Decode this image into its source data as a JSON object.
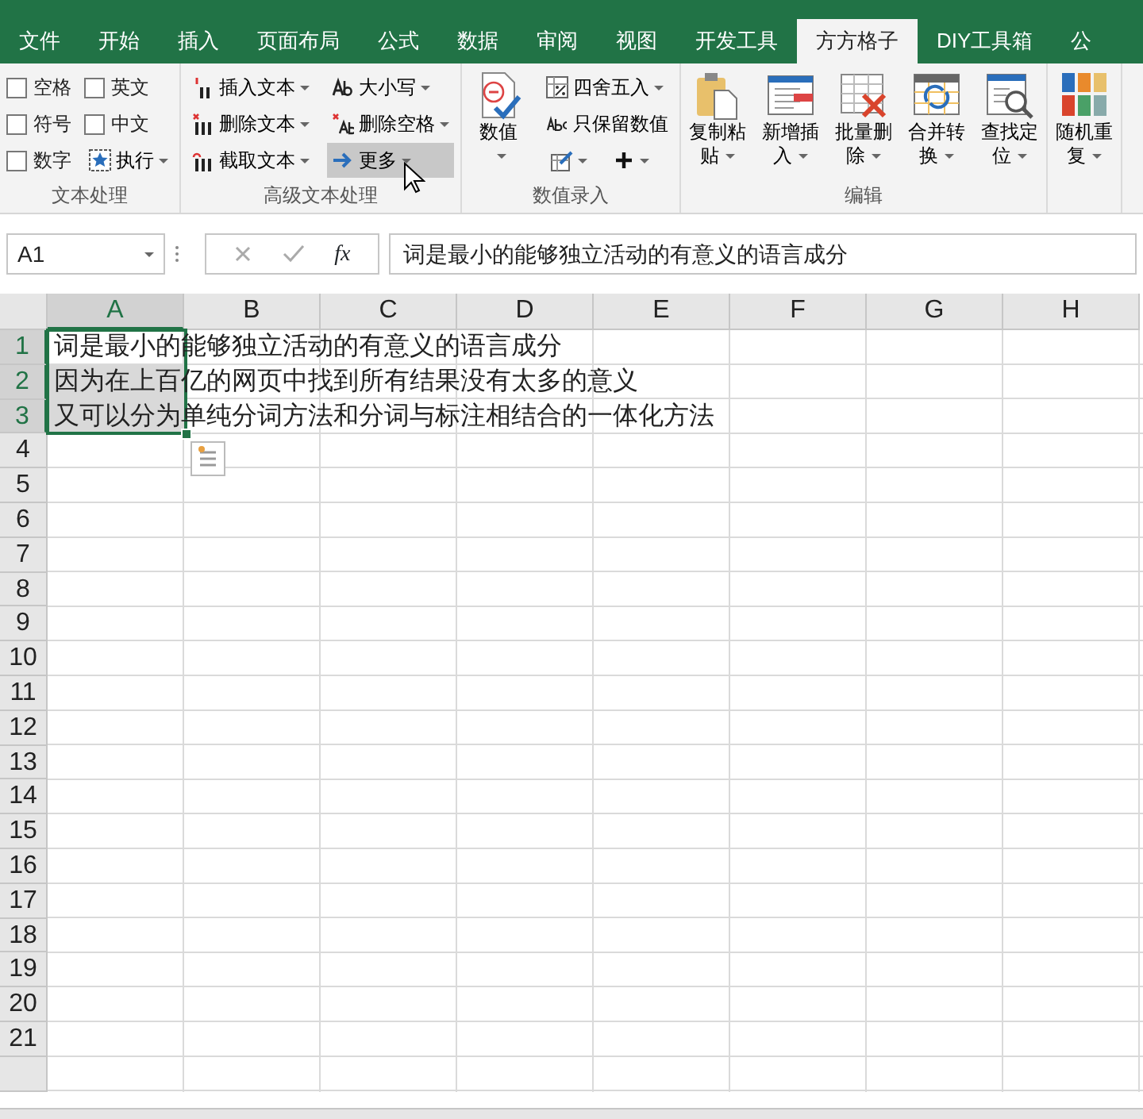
{
  "tabs": [
    {
      "label": "文件",
      "selected": false
    },
    {
      "label": "开始",
      "selected": false
    },
    {
      "label": "插入",
      "selected": false
    },
    {
      "label": "页面布局",
      "selected": false
    },
    {
      "label": "公式",
      "selected": false
    },
    {
      "label": "数据",
      "selected": false
    },
    {
      "label": "审阅",
      "selected": false
    },
    {
      "label": "视图",
      "selected": false
    },
    {
      "label": "开发工具",
      "selected": false
    },
    {
      "label": "方方格子",
      "selected": true
    },
    {
      "label": "DIY工具箱",
      "selected": false
    },
    {
      "label": "公",
      "selected": false
    }
  ],
  "ribbon": {
    "groups": [
      {
        "label": "文本处理",
        "columns": [
          [
            {
              "kind": "checkbox",
              "label": "空格",
              "checked": false
            },
            {
              "kind": "checkbox",
              "label": "符号",
              "checked": false
            },
            {
              "kind": "checkbox",
              "label": "数字",
              "checked": false
            }
          ],
          [
            {
              "kind": "checkbox",
              "label": "英文",
              "checked": false
            },
            {
              "kind": "checkbox",
              "label": "中文",
              "checked": false
            },
            {
              "kind": "small",
              "label": "执行",
              "dropdown": true,
              "hovered": false
            }
          ]
        ]
      },
      {
        "label": "高级文本处理",
        "columns": [
          [
            {
              "kind": "small",
              "label": "插入文本",
              "dropdown": true,
              "hovered": false
            },
            {
              "kind": "small",
              "label": "删除文本",
              "dropdown": true,
              "hovered": false
            },
            {
              "kind": "small",
              "label": "截取文本",
              "dropdown": true,
              "hovered": false
            }
          ],
          [
            {
              "kind": "small",
              "label": "大小写",
              "dropdown": true,
              "hovered": false
            },
            {
              "kind": "small",
              "label": "删除空格",
              "dropdown": true,
              "hovered": false
            },
            {
              "kind": "small",
              "label": "更多",
              "dropdown": true,
              "hovered": true
            }
          ]
        ]
      },
      {
        "label": "数值录入",
        "columns": [
          [
            {
              "kind": "large",
              "label": "数值",
              "dropdown": true
            }
          ],
          [
            {
              "kind": "small",
              "label": "四舍五入",
              "dropdown": true,
              "hovered": false
            },
            {
              "kind": "small",
              "label": "只保留数值",
              "dropdown": false,
              "hovered": false
            },
            {
              "kind": "tools",
              "tools": [
                {
                  "dropdown": true
                },
                {
                  "dropdown": true
                }
              ]
            }
          ]
        ]
      },
      {
        "label": "编辑",
        "columns": [
          [
            {
              "kind": "large",
              "label": "复制粘贴",
              "dropdown": true
            }
          ],
          [
            {
              "kind": "large",
              "label": "新增插入",
              "dropdown": true
            }
          ],
          [
            {
              "kind": "large",
              "label": "批量删除",
              "dropdown": true
            }
          ],
          [
            {
              "kind": "large",
              "label": "合并转换",
              "dropdown": true
            }
          ],
          [
            {
              "kind": "large",
              "label": "查找定位",
              "dropdown": true
            }
          ]
        ]
      },
      {
        "columns": [
          [
            {
              "kind": "large",
              "label": "随机重复",
              "dropdown": true
            }
          ]
        ]
      }
    ]
  },
  "formula_bar": {
    "name_box": "A1",
    "function_label": "fx",
    "formula": "词是最小的能够独立活动的有意义的语言成分"
  },
  "sheet": {
    "columns": [
      {
        "label": "A",
        "selected": true
      },
      {
        "label": "B",
        "selected": false
      },
      {
        "label": "C",
        "selected": false
      },
      {
        "label": "D",
        "selected": false
      },
      {
        "label": "E",
        "selected": false
      },
      {
        "label": "F",
        "selected": false
      },
      {
        "label": "G",
        "selected": false
      },
      {
        "label": "H",
        "selected": false
      }
    ],
    "rows": [
      {
        "header": "1",
        "selected": true,
        "column_a": "词是最小的能够独立活动的有意义的语言成分"
      },
      {
        "header": "2",
        "selected": true,
        "column_a": "因为在上百亿的网页中找到所有结果没有太多的意义"
      },
      {
        "header": "3",
        "selected": true,
        "column_a": "又可以分为单纯分词方法和分词与标注相结合的一体化方法"
      },
      {
        "header": "4",
        "selected": false
      },
      {
        "header": "5",
        "selected": false
      },
      {
        "header": "6",
        "selected": false
      },
      {
        "header": "7",
        "selected": false
      },
      {
        "header": "8",
        "selected": false
      },
      {
        "header": "9",
        "selected": false
      },
      {
        "header": "10",
        "selected": false
      },
      {
        "header": "11",
        "selected": false
      },
      {
        "header": "12",
        "selected": false
      },
      {
        "header": "13",
        "selected": false
      },
      {
        "header": "14",
        "selected": false
      },
      {
        "header": "15",
        "selected": false
      },
      {
        "header": "16",
        "selected": false
      },
      {
        "header": "17",
        "selected": false
      },
      {
        "header": "18",
        "selected": false
      },
      {
        "header": "19",
        "selected": false
      },
      {
        "header": "20",
        "selected": false
      },
      {
        "header": "21",
        "selected": false
      }
    ]
  }
}
